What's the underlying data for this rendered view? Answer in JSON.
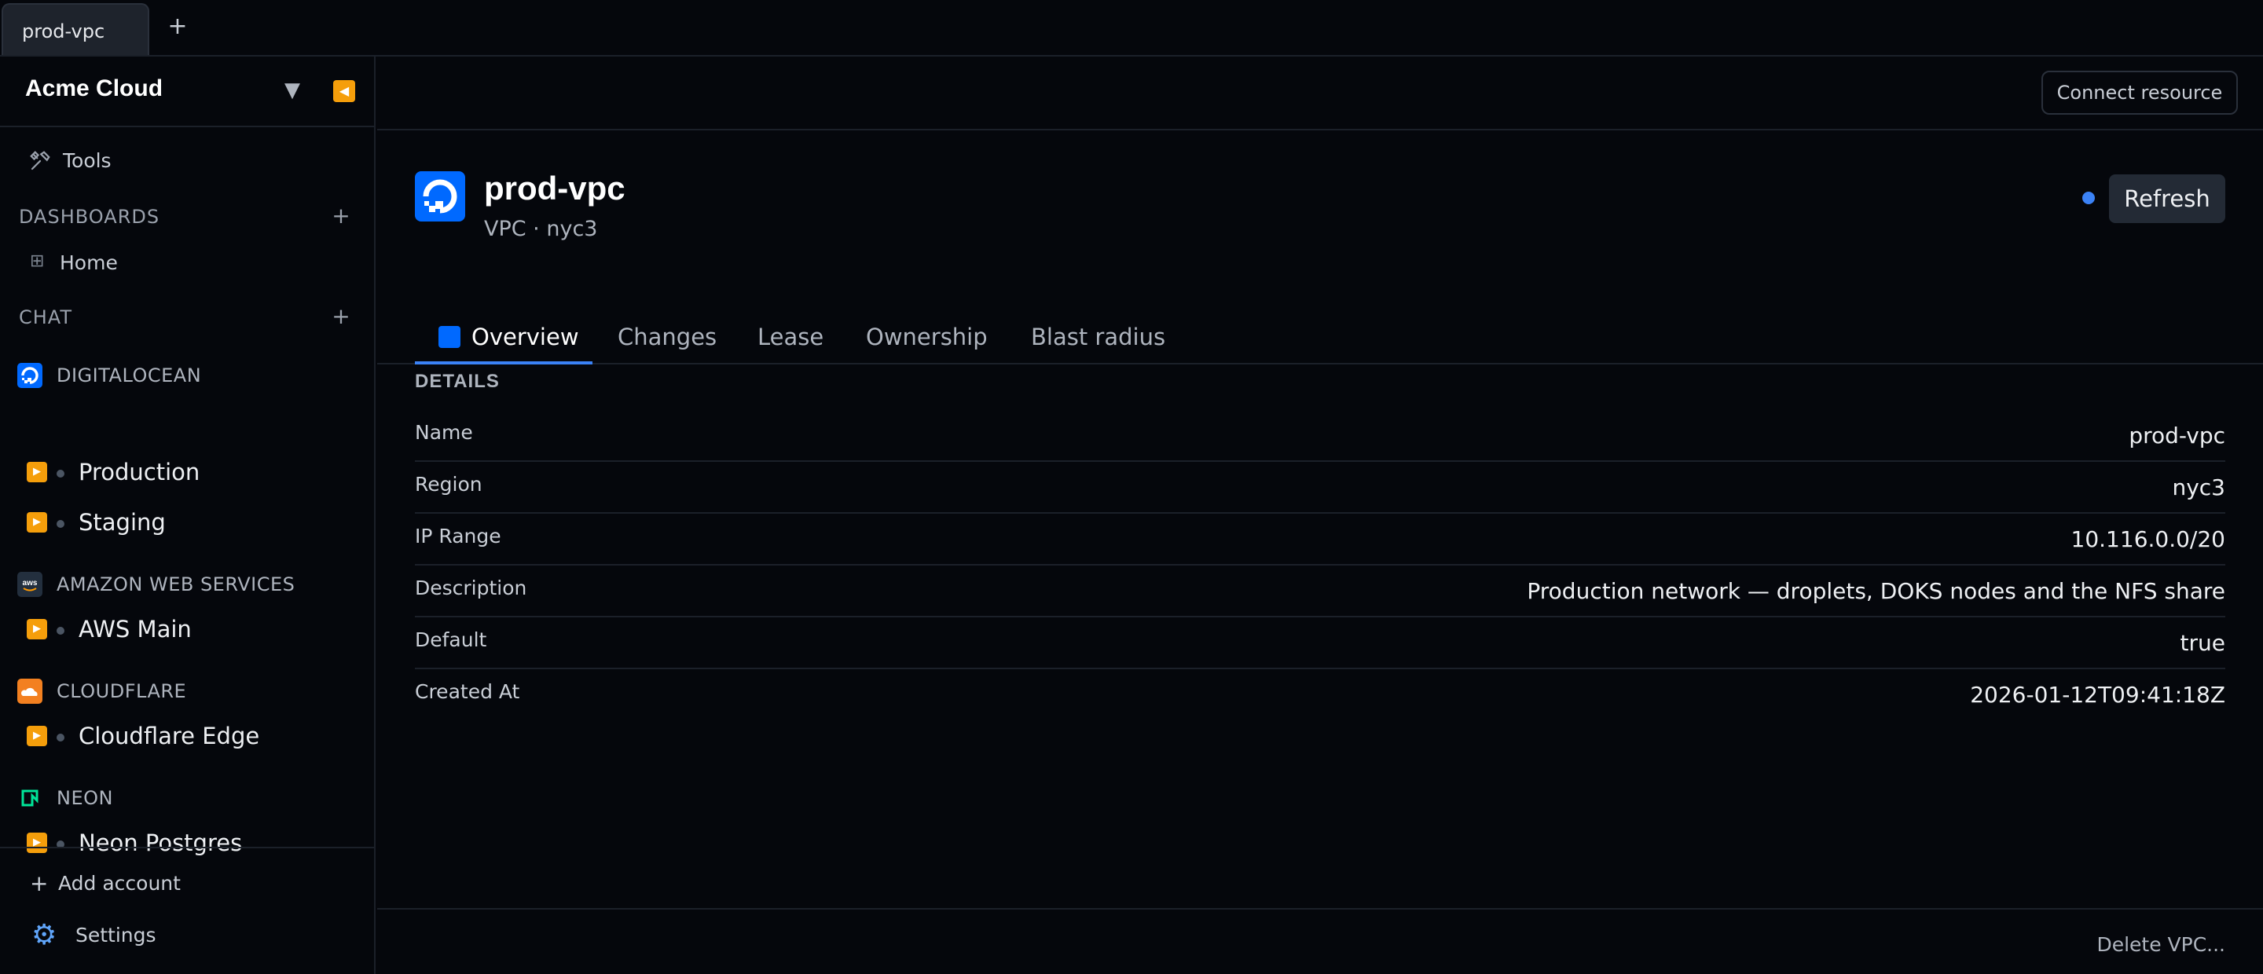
{
  "tab_strip": {
    "tabs": [
      {
        "label": "prod-vpc"
      }
    ],
    "add_symbol": "+"
  },
  "sidebar": {
    "workspace": "Acme Cloud",
    "tools_label": "Tools",
    "dashboards": {
      "title": "DASHBOARDS",
      "add": "+",
      "items": [
        {
          "label": "Home"
        }
      ]
    },
    "chat": {
      "title": "CHAT",
      "add": "+"
    },
    "providers": [
      {
        "name": "DIGITALOCEAN",
        "icon": "digitalocean-icon",
        "color": "#0069ff",
        "accounts": [
          {
            "label": "Production"
          },
          {
            "label": "Staging"
          }
        ]
      },
      {
        "name": "AMAZON WEB SERVICES",
        "icon": "aws-icon",
        "color": "#232f3e",
        "accounts": [
          {
            "label": "AWS Main"
          }
        ]
      },
      {
        "name": "CLOUDFLARE",
        "icon": "cloudflare-icon",
        "color": "#f38020",
        "accounts": [
          {
            "label": "Cloudflare Edge"
          }
        ]
      },
      {
        "name": "NEON",
        "icon": "neon-icon",
        "color": "#00e599",
        "accounts": [
          {
            "label": "Neon Postgres"
          }
        ]
      }
    ],
    "footer": {
      "add_account": "Add account",
      "add_symbol": "+",
      "settings": "Settings"
    }
  },
  "main": {
    "connect_button": "Connect resource",
    "resource": {
      "title": "prod-vpc",
      "subtitle": "VPC · nyc3"
    },
    "refresh_button": "Refresh",
    "tabs": [
      {
        "label": "Overview",
        "active": true
      },
      {
        "label": "Changes",
        "active": false
      },
      {
        "label": "Lease",
        "active": false
      },
      {
        "label": "Ownership",
        "active": false
      },
      {
        "label": "Blast radius",
        "active": false
      }
    ],
    "details_heading": "DETAILS",
    "details": [
      {
        "key": "Name",
        "value": "prod-vpc"
      },
      {
        "key": "Region",
        "value": "nyc3"
      },
      {
        "key": "IP Range",
        "value": "10.116.0.0/20"
      },
      {
        "key": "Description",
        "value": "Production network — droplets, DOKS nodes and the NFS share"
      },
      {
        "key": "Default",
        "value": "true"
      },
      {
        "key": "Created At",
        "value": "2026-01-12T09:41:18Z"
      }
    ],
    "delete_link": "Delete VPC..."
  },
  "colors": {
    "accent": "#3b82f6",
    "account_icon": "#f59e0b",
    "background": "#05070c"
  }
}
